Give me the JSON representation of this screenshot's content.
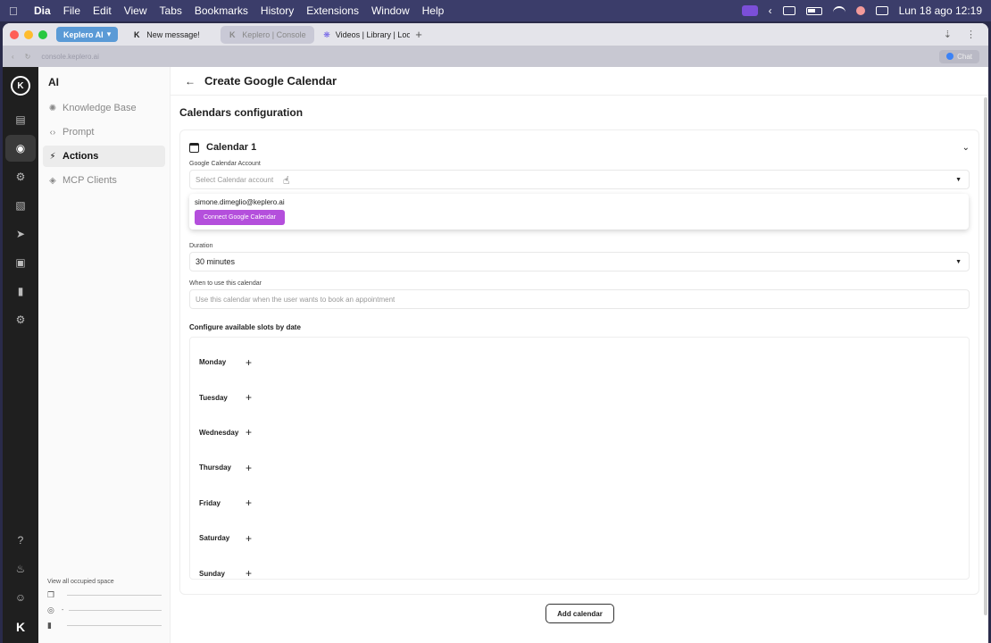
{
  "menubar": {
    "app_name": "Dia",
    "menus": [
      "File",
      "Edit",
      "View",
      "Tabs",
      "Bookmarks",
      "History",
      "Extensions",
      "Window",
      "Help"
    ],
    "clock": "Lun 18 ago  12:19"
  },
  "browser": {
    "profile": "Keplero AI",
    "tabs": [
      {
        "label": "New message!",
        "active": false
      },
      {
        "label": "Keplero | Console",
        "active": true
      },
      {
        "label": "Videos | Library | Loom",
        "active": false
      }
    ],
    "url": "console.keplero.ai",
    "chat_label": "Chat"
  },
  "subnav": {
    "title": "AI",
    "items": [
      {
        "label": "Knowledge Base",
        "icon": "brain-icon"
      },
      {
        "label": "Prompt",
        "icon": "code-icon"
      },
      {
        "label": "Actions",
        "icon": "bolt-icon"
      },
      {
        "label": "MCP Clients",
        "icon": "mcp-icon"
      }
    ],
    "occupied_label": "View all occupied space",
    "occupied_rows": [
      {
        "icon": "document-stack-icon",
        "value": ""
      },
      {
        "icon": "globe-icon",
        "value": "-"
      },
      {
        "icon": "file-icon",
        "value": ""
      }
    ]
  },
  "page": {
    "title": "Create Google Calendar",
    "section_title": "Calendars configuration",
    "card_title": "Calendar 1",
    "account_label": "Google Calendar Account",
    "account_placeholder": "Select Calendar account",
    "dropdown_email": "simone.dimeglio@keplero.ai",
    "dropdown_connect": "Connect Google Calendar",
    "duration_label": "Duration",
    "duration_value": "30 minutes",
    "when_label": "When to use this calendar",
    "when_placeholder": "Use this calendar when the user wants to book an appointment",
    "slots_title": "Configure available slots by date",
    "days": [
      "Monday",
      "Tuesday",
      "Wednesday",
      "Thursday",
      "Friday",
      "Saturday",
      "Sunday"
    ],
    "add_calendar": "Add calendar"
  }
}
